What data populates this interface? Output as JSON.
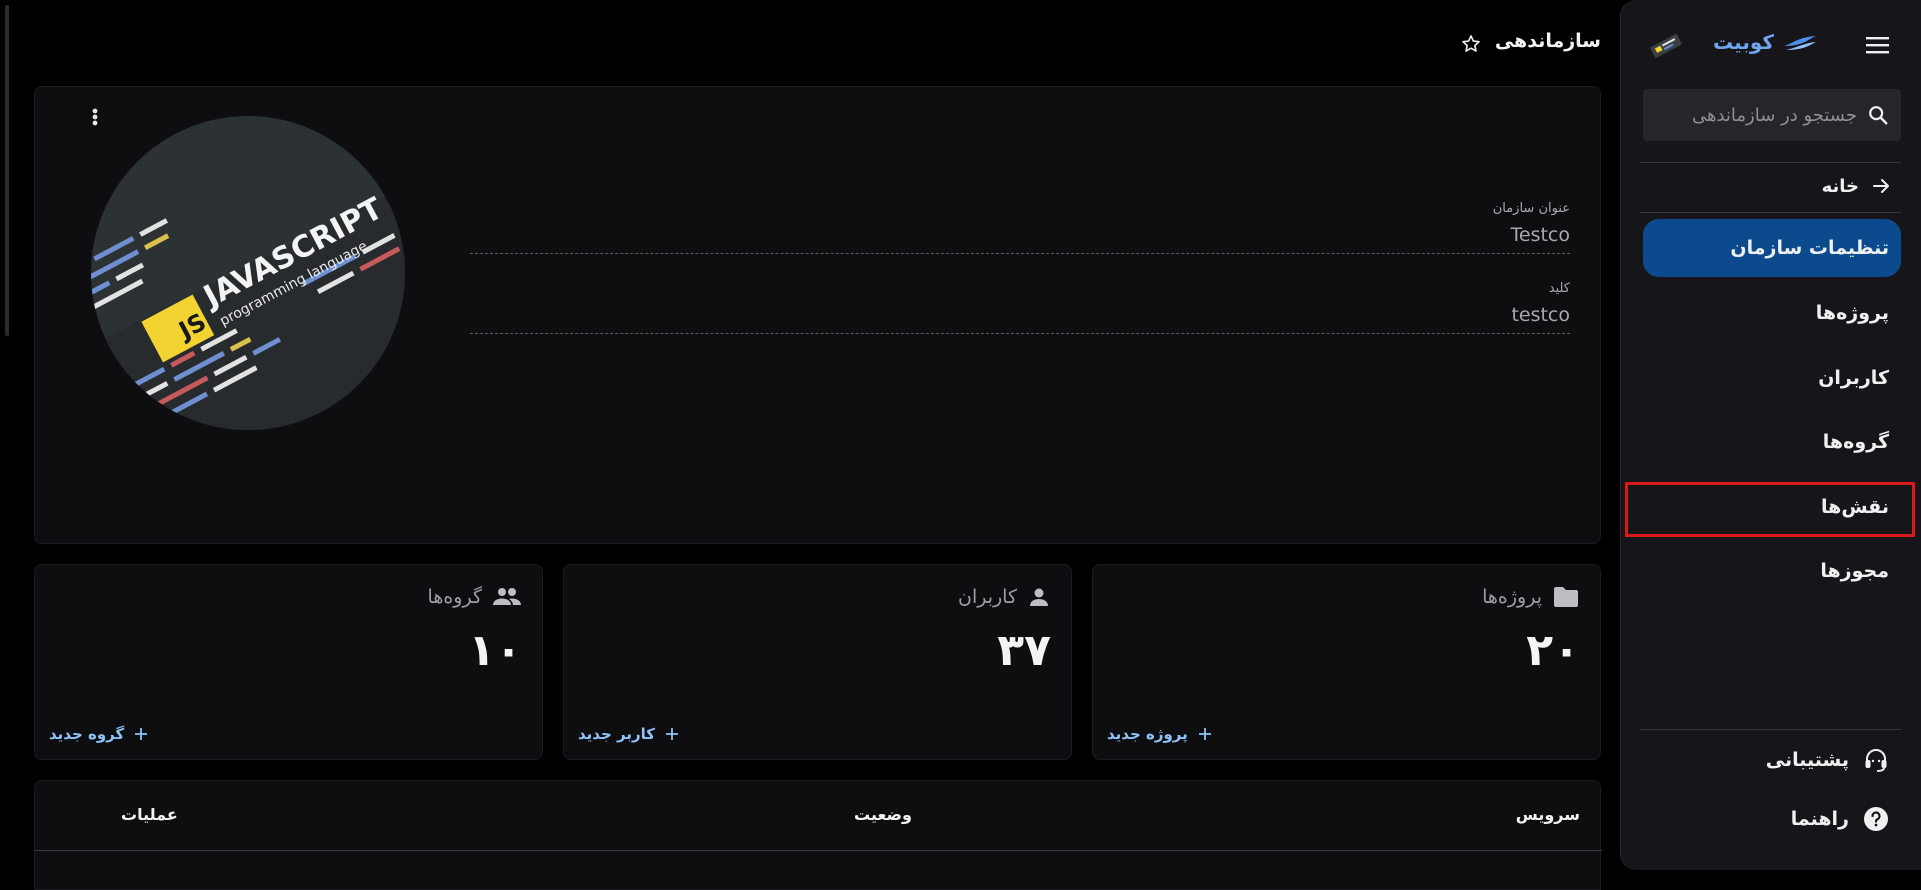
{
  "header": {
    "title": "سازماندهی",
    "star_icon": "star-outline-icon"
  },
  "sidebar": {
    "brand_name": "کوبیت",
    "search_placeholder": "جستجو در سازماندهی",
    "home_label": "خانه",
    "items": [
      {
        "label": "تنظیمات سازمان",
        "active": true
      },
      {
        "label": "پروژه‌ها"
      },
      {
        "label": "کاربران"
      },
      {
        "label": "گروه‌ها"
      },
      {
        "label": "نقش‌ها",
        "highlighted": true
      },
      {
        "label": "مجوزها"
      }
    ],
    "footer": {
      "support_label": "پشتیبانی",
      "help_label": "راهنما"
    },
    "accent_color": "#0c4a8e",
    "highlight_color": "#d7191b"
  },
  "org": {
    "name_label": "عنوان سازمان",
    "name_value": "Testco",
    "key_label": "کلید",
    "key_value": "testco",
    "logo": {
      "brand": "JAVASCRIPT",
      "subtitle": "programming language",
      "badge": "JS"
    }
  },
  "stats": [
    {
      "label": "پروژه‌ها",
      "value": "۲۰",
      "action": "پروژه جدید",
      "icon": "folder-icon"
    },
    {
      "label": "کاربران",
      "value": "۳۷",
      "action": "کاربر جدید",
      "icon": "user-icon"
    },
    {
      "label": "گروه‌ها",
      "value": "۱۰",
      "action": "گروه جدید",
      "icon": "group-icon"
    }
  ],
  "table": {
    "columns": [
      "سرویس",
      "وضعیت",
      "عملیات"
    ]
  }
}
